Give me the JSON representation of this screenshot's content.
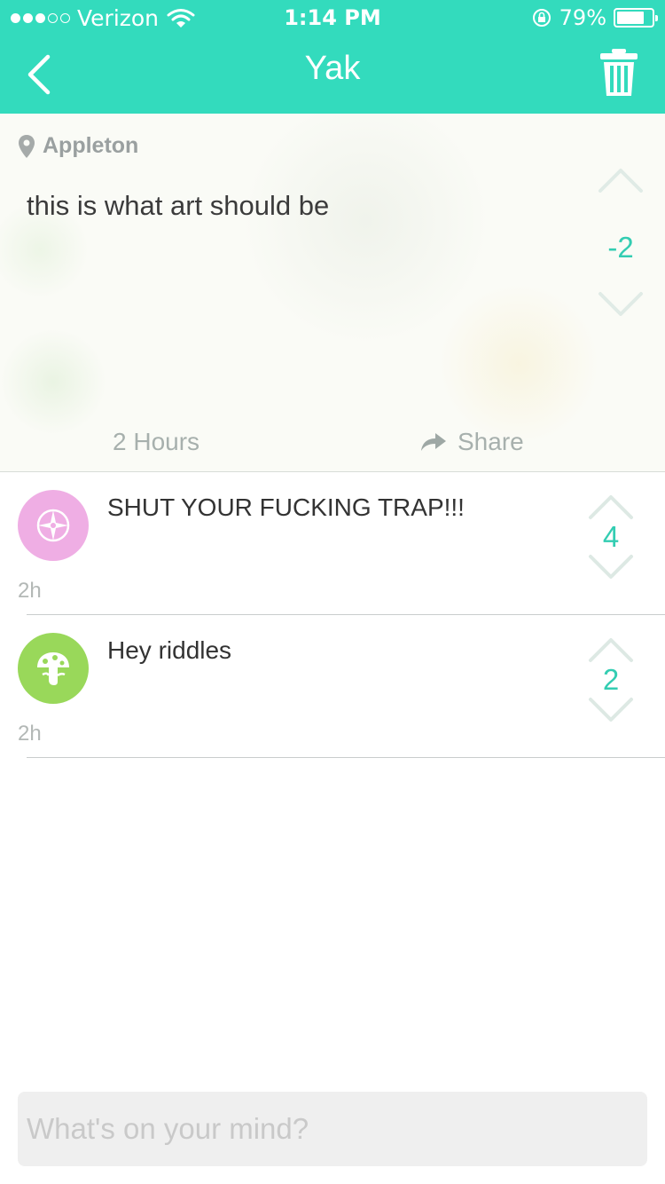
{
  "status_bar": {
    "carrier": "Verizon",
    "time": "1:14 PM",
    "battery": "79%",
    "battery_level": 0.79
  },
  "nav": {
    "title": "Yak"
  },
  "post": {
    "location": "Appleton",
    "text": "this is what art should be",
    "score": "-2",
    "age": "2 Hours",
    "share_label": "Share"
  },
  "comments": [
    {
      "text": "SHUT YOUR FUCKING TRAP!!!",
      "score": "4",
      "time": "2h",
      "avatar_color": "#efaee4",
      "icon": "compass-icon"
    },
    {
      "text": "Hey riddles",
      "score": "2",
      "time": "2h",
      "avatar_color": "#99d85a",
      "icon": "mushroom-icon"
    }
  ],
  "composer": {
    "placeholder": "What's on your mind?"
  },
  "colors": {
    "accent": "#33dbbd",
    "score": "#33cdb2"
  }
}
